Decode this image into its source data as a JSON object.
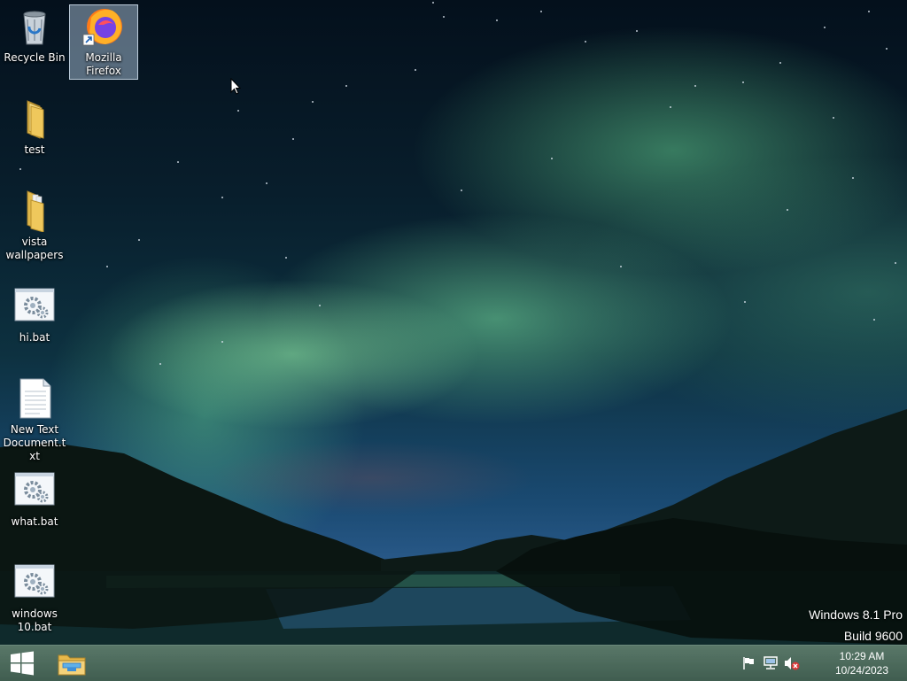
{
  "desktop": {
    "icons": [
      {
        "label": "Recycle Bin",
        "icon": "recycle-bin-icon"
      },
      {
        "label": "Mozilla Firefox",
        "icon": "firefox-icon",
        "selected": true
      },
      {
        "label": "test",
        "icon": "folder-icon"
      },
      {
        "label": "vista wallpapers",
        "icon": "folder-icon"
      },
      {
        "label": "hi.bat",
        "icon": "batch-file-icon"
      },
      {
        "label": "New Text Document.txt",
        "icon": "text-file-icon"
      },
      {
        "label": "what.bat",
        "icon": "batch-file-icon"
      },
      {
        "label": "windows 10.bat",
        "icon": "batch-file-icon"
      }
    ]
  },
  "watermark": {
    "line1": "Windows 8.1 Pro",
    "line2": "Build 9600"
  },
  "taskbar": {
    "start_icon": "windows-logo-icon",
    "pinned": [
      {
        "icon": "file-explorer-icon"
      }
    ],
    "tray": [
      {
        "icon": "action-center-flag-icon"
      },
      {
        "icon": "network-icon"
      },
      {
        "icon": "speaker-muted-icon"
      }
    ],
    "clock": {
      "time": "10:29 AM",
      "date": "10/24/2023"
    }
  },
  "colors": {
    "taskbar": "#4f6f60",
    "selection": "#bed7f0",
    "text": "#ffffff"
  }
}
